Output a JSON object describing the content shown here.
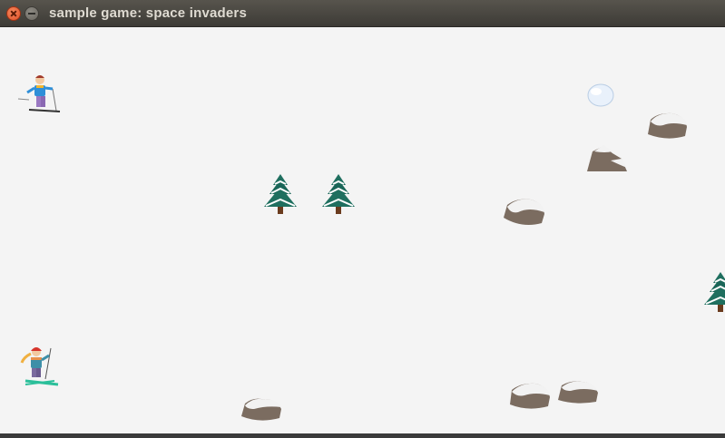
{
  "window": {
    "title": "sample game: space invaders",
    "close_icon": "close-icon",
    "minimize_icon": "minimize-icon"
  },
  "game": {
    "background_color": "#f4f4f4",
    "players": [
      {
        "name": "skier-player-1",
        "sprite": "skier-boy-icon"
      },
      {
        "name": "skier-player-2",
        "sprite": "skier-girl-icon"
      }
    ],
    "obstacles": [
      {
        "type": "tree",
        "icon": "pine-tree-icon"
      },
      {
        "type": "tree",
        "icon": "pine-tree-icon"
      },
      {
        "type": "tree",
        "icon": "pine-tree-icon"
      },
      {
        "type": "rock",
        "icon": "snow-rock-icon"
      },
      {
        "type": "rock",
        "icon": "snow-rock-icon"
      },
      {
        "type": "rock",
        "icon": "snow-rock-icon"
      },
      {
        "type": "rock",
        "icon": "snow-rock-icon"
      },
      {
        "type": "rock",
        "icon": "snow-rock-icon"
      },
      {
        "type": "rock",
        "icon": "snow-rock-icon"
      },
      {
        "type": "snowball",
        "icon": "snowball-icon"
      }
    ]
  }
}
